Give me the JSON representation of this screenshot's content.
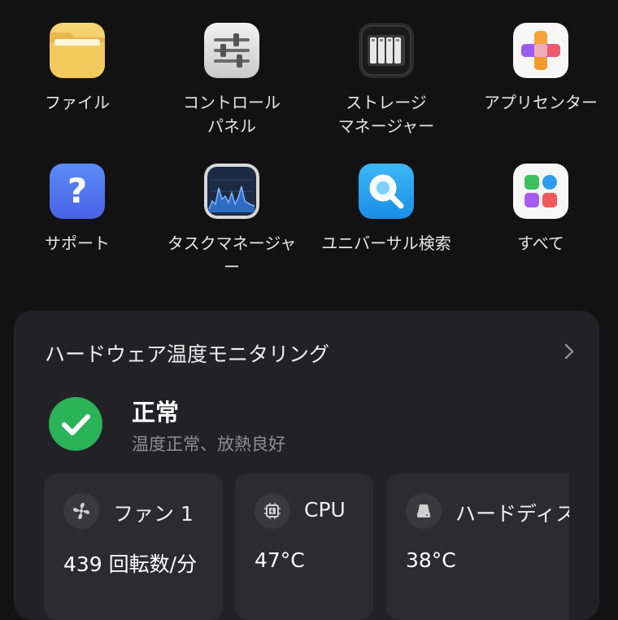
{
  "apps": [
    {
      "icon": "folder-icon",
      "label_lines": [
        "ファイル"
      ]
    },
    {
      "icon": "sliders-icon",
      "label_lines": [
        "コントロール",
        "パネル"
      ]
    },
    {
      "icon": "storage-drives-icon",
      "label_lines": [
        "ストレージ",
        "マネージャー"
      ]
    },
    {
      "icon": "app-center-icon",
      "label_lines": [
        "アプリセンター"
      ]
    },
    {
      "icon": "question-icon",
      "label_lines": [
        "サポート"
      ]
    },
    {
      "icon": "activity-graph-icon",
      "label_lines": [
        "タスクマネージャ",
        "ー"
      ]
    },
    {
      "icon": "magnifier-icon",
      "label_lines": [
        "ユニバーサル検索"
      ]
    },
    {
      "icon": "grid-all-icon",
      "label_lines": [
        "すべて"
      ]
    }
  ],
  "monitor": {
    "title": "ハードウェア温度モニタリング",
    "status": {
      "title": "正常",
      "subtitle": "温度正常、放熱良好",
      "color": "#2bb35a"
    },
    "tiles": [
      {
        "icon": "fan-icon",
        "name": "ファン 1",
        "value": "439 回転数/分"
      },
      {
        "icon": "cpu-chip-icon",
        "name": "CPU",
        "value": "47°C"
      },
      {
        "icon": "hard-disk-icon",
        "name": "ハードディスク",
        "value": "38°C"
      }
    ]
  }
}
